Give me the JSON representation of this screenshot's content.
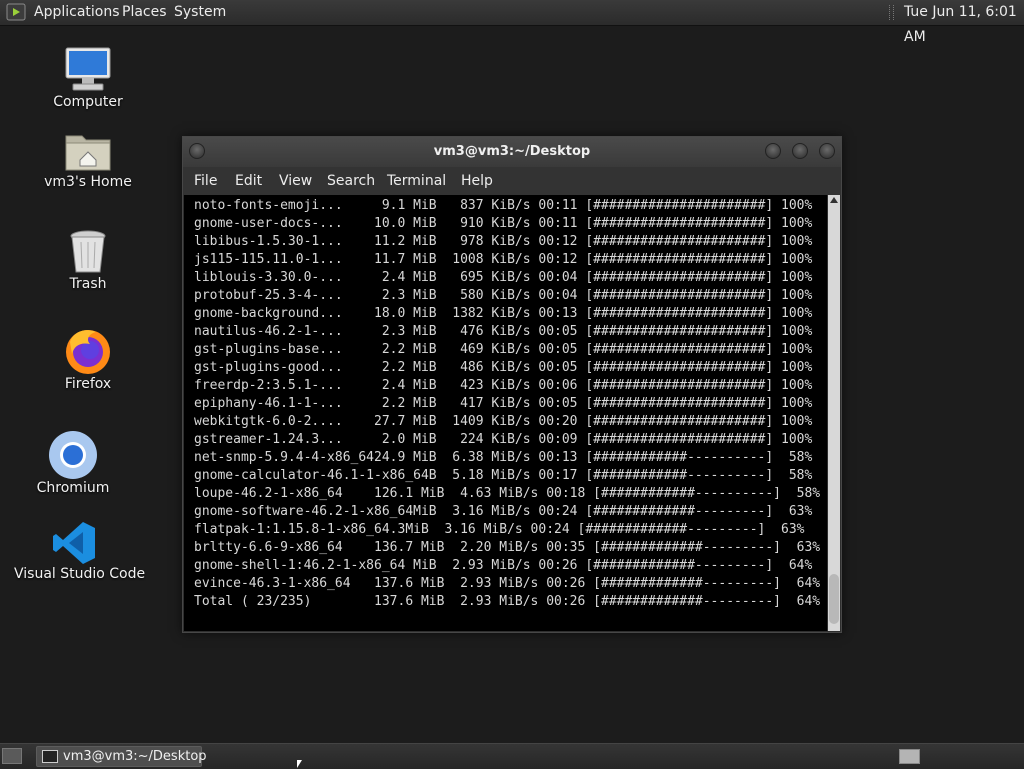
{
  "top_panel": {
    "menus": [
      "Applications",
      "Places",
      "System"
    ],
    "clock": "Tue Jun 11,  6:01 AM"
  },
  "desktop": {
    "icons": [
      {
        "label": "Computer",
        "icon": "computer-icon"
      },
      {
        "label": "vm3's Home",
        "icon": "home-folder-icon"
      },
      {
        "label": "Trash",
        "icon": "trash-icon"
      },
      {
        "label": "Firefox",
        "icon": "firefox-icon"
      },
      {
        "label": "Chromium",
        "icon": "chromium-icon"
      },
      {
        "label": "Visual Studio Code",
        "icon": "vscode-icon"
      }
    ]
  },
  "terminal": {
    "title": "vm3@vm3:~/Desktop",
    "menu": [
      "File",
      "Edit",
      "View",
      "Search",
      "Terminal",
      "Help"
    ],
    "lines": [
      "noto-fonts-emoji...     9.1 MiB   837 KiB/s 00:11 [######################] 100%",
      "gnome-user-docs-...    10.0 MiB   910 KiB/s 00:11 [######################] 100%",
      "libibus-1.5.30-1...    11.2 MiB   978 KiB/s 00:12 [######################] 100%",
      "js115-115.11.0-1...    11.7 MiB  1008 KiB/s 00:12 [######################] 100%",
      "liblouis-3.30.0-...     2.4 MiB   695 KiB/s 00:04 [######################] 100%",
      "protobuf-25.3-4-...     2.3 MiB   580 KiB/s 00:04 [######################] 100%",
      "gnome-background...    18.0 MiB  1382 KiB/s 00:13 [######################] 100%",
      "nautilus-46.2-1-...     2.3 MiB   476 KiB/s 00:05 [######################] 100%",
      "gst-plugins-base...     2.2 MiB   469 KiB/s 00:05 [######################] 100%",
      "gst-plugins-good...     2.2 MiB   486 KiB/s 00:05 [######################] 100%",
      "freerdp-2:3.5.1-...     2.4 MiB   423 KiB/s 00:06 [######################] 100%",
      "epiphany-46.1-1-...     2.2 MiB   417 KiB/s 00:05 [######################] 100%",
      "webkitgtk-6.0-2....    27.7 MiB  1409 KiB/s 00:20 [######################] 100%",
      "gstreamer-1.24.3...     2.0 MiB   224 KiB/s 00:09 [######################] 100%",
      "net-snmp-5.9.4-4-x86_6424.9 MiB  6.38 MiB/s 00:13 [############----------]  58%",
      "gnome-calculator-46.1-1-x86_64B  5.18 MiB/s 00:17 [############----------]  58%",
      "loupe-46.2-1-x86_64    126.1 MiB  4.63 MiB/s 00:18 [############----------]  58%",
      "gnome-software-46.2-1-x86_64MiB  3.16 MiB/s 00:24 [#############---------]  63%",
      "flatpak-1:1.15.8-1-x86_64.3MiB  3.16 MiB/s 00:24 [#############---------]  63%",
      "brltty-6.6-9-x86_64    136.7 MiB  2.20 MiB/s 00:35 [#############---------]  63%",
      "gnome-shell-1:46.2-1-x86_64 MiB  2.93 MiB/s 00:26 [#############---------]  64%",
      "evince-46.3-1-x86_64   137.6 MiB  2.93 MiB/s 00:26 [#############---------]  64%",
      "Total ( 23/235)        137.6 MiB  2.93 MiB/s 00:26 [#############---------]  64%"
    ]
  },
  "taskbar": {
    "window_button": "vm3@vm3:~/Desktop"
  }
}
